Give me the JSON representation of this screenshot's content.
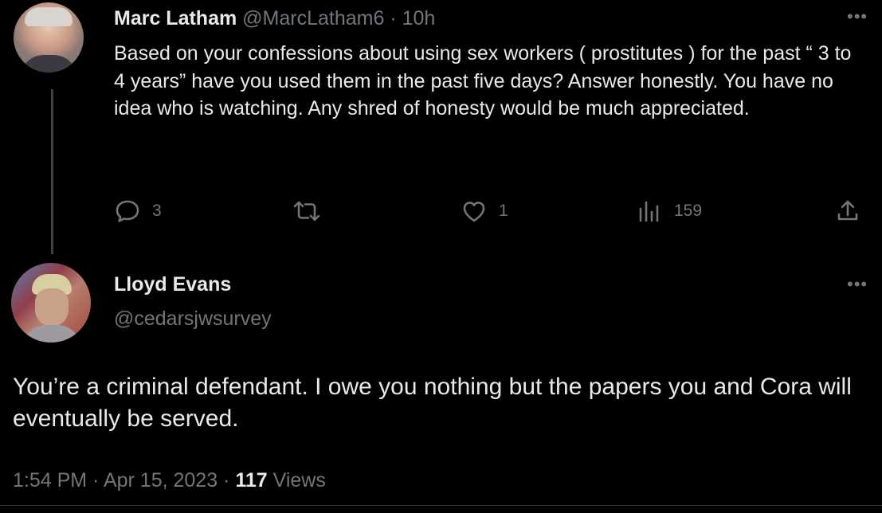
{
  "parent_tweet": {
    "author_name": "Marc Latham",
    "handle_time": "@MarcLatham6 · 10h",
    "text": "Based on your confessions about using sex workers ( prostitutes ) for the past “ 3 to 4 years” have you used them in the past five days? Answer honestly.  You have no idea who is watching.  Any shred of honesty would be much appreciated.",
    "more_icon": "more-horizontal-icon",
    "actions": {
      "replies": "3",
      "reposts": "",
      "likes": "1",
      "views": "159"
    }
  },
  "reply_tweet": {
    "author_name": "Lloyd Evans",
    "handle": "@cedarsjwsurvey",
    "text": "You’re a criminal defendant. I owe you nothing but the papers you and Cora will eventually be served.",
    "more_icon": "more-horizontal-icon",
    "meta": {
      "timestamp": "1:54 PM · Apr 15, 2023 · ",
      "views_count": "117",
      "views_label": " Views"
    }
  },
  "colors": {
    "background": "#000000",
    "primary_text": "#e7e9ea",
    "secondary_text": "#71767b",
    "thread_line": "#3d4147",
    "divider": "#2f3336"
  }
}
